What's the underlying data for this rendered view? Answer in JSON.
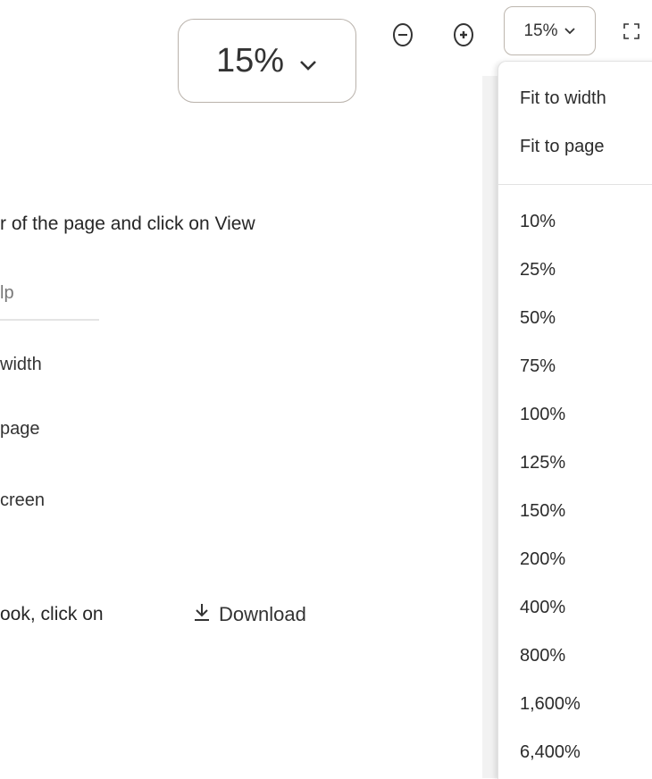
{
  "left_toolbar": {
    "zoom_out_icon": "minus-circle",
    "zoom_in_icon": "plus-circle",
    "zoom_value": "15%",
    "chevron_icon": "chevron-down"
  },
  "document": {
    "instruction_line": "r of the page and click on View",
    "menu_header_fragment": "lp",
    "menu_items": [
      "width",
      "page",
      "creen"
    ],
    "download_prefix": "ook, click on",
    "download_label": "Download",
    "download_icon": "download-arrow"
  },
  "right_toolbar": {
    "zoom_value": "15%",
    "chevron_icon": "chevron-down",
    "fullscreen_icon": "fullscreen-corners"
  },
  "zoom_dropdown": {
    "fit_options": [
      "Fit to width",
      "Fit to page"
    ],
    "percent_options": [
      "10%",
      "25%",
      "50%",
      "75%",
      "100%",
      "125%",
      "150%",
      "200%",
      "400%",
      "800%",
      "1,600%",
      "6,400%"
    ]
  }
}
